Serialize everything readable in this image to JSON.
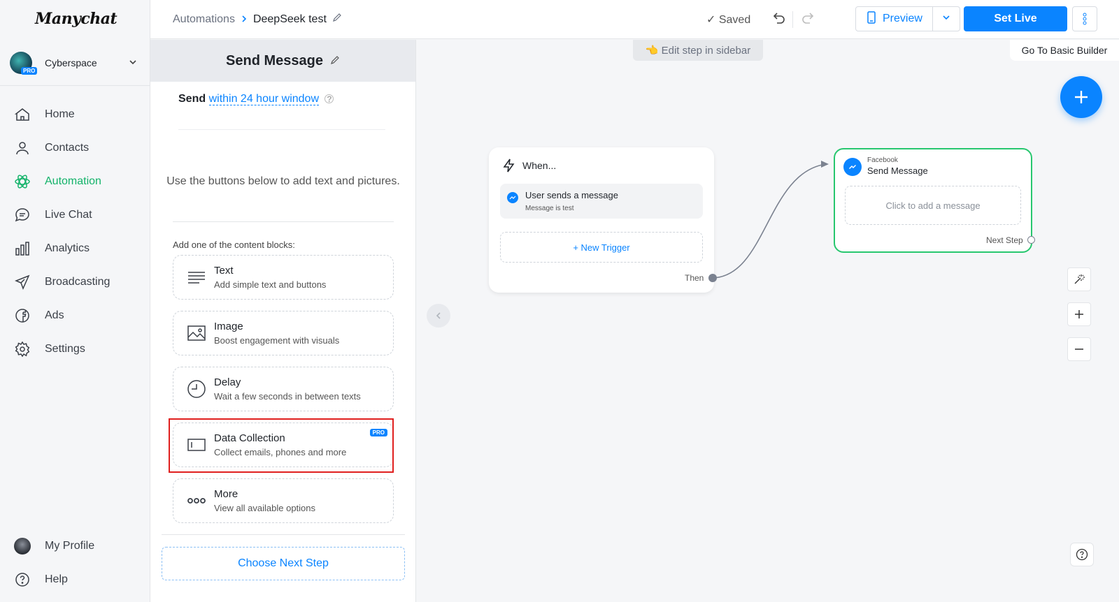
{
  "brand": {
    "logo": "Manychat",
    "accent": "#0a84ff",
    "active": "#13b36a"
  },
  "account": {
    "name": "Cyberspace",
    "badge": "PRO"
  },
  "nav": {
    "items": [
      {
        "label": "Home",
        "icon": "home-icon"
      },
      {
        "label": "Contacts",
        "icon": "contacts-icon"
      },
      {
        "label": "Automation",
        "icon": "automation-icon",
        "active": true
      },
      {
        "label": "Live Chat",
        "icon": "chat-icon"
      },
      {
        "label": "Analytics",
        "icon": "analytics-icon"
      },
      {
        "label": "Broadcasting",
        "icon": "broadcast-icon"
      },
      {
        "label": "Ads",
        "icon": "ads-icon"
      },
      {
        "label": "Settings",
        "icon": "gear-icon"
      }
    ],
    "bottom": [
      {
        "label": "My Profile",
        "icon": "profile-avatar"
      },
      {
        "label": "Help",
        "icon": "help-icon"
      }
    ]
  },
  "topbar": {
    "breadcrumb_root": "Automations",
    "breadcrumb_current": "DeepSeek test",
    "saved": "Saved",
    "preview": "Preview",
    "set_live": "Set Live"
  },
  "panel": {
    "title": "Send Message",
    "send_prefix": "Send",
    "send_window": "within 24 hour window",
    "hint": "Use the buttons below to add text and pictures.",
    "add_label": "Add one of the content blocks:",
    "blocks": [
      {
        "title": "Text",
        "subtitle": "Add simple text and buttons",
        "icon": "text-lines-icon"
      },
      {
        "title": "Image",
        "subtitle": "Boost engagement with visuals",
        "icon": "image-icon"
      },
      {
        "title": "Delay",
        "subtitle": "Wait a few seconds in between texts",
        "icon": "clock-icon"
      },
      {
        "title": "Data Collection",
        "subtitle": "Collect emails, phones and more",
        "icon": "input-field-icon",
        "badge": "PRO"
      },
      {
        "title": "More",
        "subtitle": "View all available options",
        "icon": "more-dots-icon"
      }
    ],
    "next_step": "Choose Next Step"
  },
  "canvas": {
    "edit_hint": "👈 Edit step in sidebar",
    "basic_builder": "Go To Basic Builder",
    "when_node": {
      "title": "When...",
      "trigger_title": "User sends a message",
      "trigger_sub": "Message is test",
      "new_trigger": "+ New Trigger",
      "then": "Then"
    },
    "send_node": {
      "channel": "Facebook",
      "title": "Send Message",
      "placeholder": "Click to add a message",
      "next": "Next Step"
    }
  }
}
